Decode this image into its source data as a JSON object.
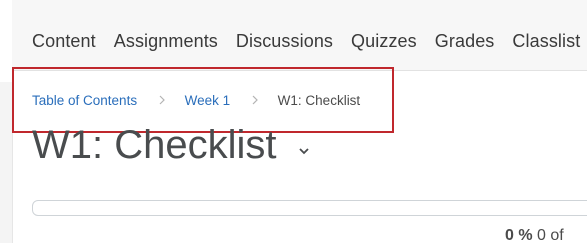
{
  "nav": {
    "items": [
      {
        "label": "Content"
      },
      {
        "label": "Assignments"
      },
      {
        "label": "Discussions"
      },
      {
        "label": "Quizzes"
      },
      {
        "label": "Grades"
      },
      {
        "label": "Classlist"
      }
    ]
  },
  "breadcrumb": {
    "items": [
      {
        "label": "Table of Contents"
      },
      {
        "label": "Week 1"
      },
      {
        "label": "W1: Checklist"
      }
    ],
    "separator_icon": "chevron-right-icon"
  },
  "page": {
    "title": "W1: Checklist",
    "title_menu_icon": "chevron-down-icon"
  },
  "progress": {
    "fraction": 0,
    "percent_text": "0 %",
    "of_text": "0 of"
  },
  "colors": {
    "link": "#2a6ebb",
    "highlight": "#c0282d",
    "title": "#494c4e"
  }
}
